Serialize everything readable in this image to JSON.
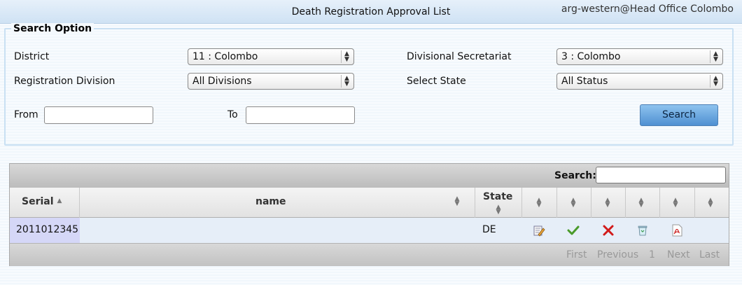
{
  "header": {
    "title": "Death Registration Approval List",
    "user": "arg-western@Head Office Colombo"
  },
  "search_option": {
    "legend": "Search Option",
    "district": {
      "label": "District",
      "value": "11 : Colombo"
    },
    "ds": {
      "label": "Divisional Secretariat",
      "value": "3 : Colombo"
    },
    "division": {
      "label": "Registration Division",
      "value": "All Divisions"
    },
    "state": {
      "label": "Select State",
      "value": "All Status"
    },
    "from": {
      "label": "From",
      "value": ""
    },
    "to": {
      "label": "To",
      "value": ""
    },
    "button": "Search"
  },
  "table": {
    "search_label": "Search:",
    "search_value": "",
    "columns": [
      "Serial",
      "name",
      "State"
    ],
    "rows": [
      {
        "serial": "2011012345",
        "name": "",
        "state": "DE"
      }
    ],
    "actions": [
      "edit-icon",
      "approve-check-icon",
      "reject-x-icon",
      "delete-bin-icon",
      "print-pdf-icon"
    ],
    "pagination": [
      "First",
      "Previous",
      "1",
      "Next",
      "Last"
    ]
  },
  "colors": {
    "header_bg": "#d6e6f6",
    "button_blue": "#5b9bd9",
    "row_bg": "#e6eef8",
    "serial_bg": "#d5d7f7",
    "approve_green": "#4a9a2a",
    "reject_red": "#d21a1a"
  }
}
